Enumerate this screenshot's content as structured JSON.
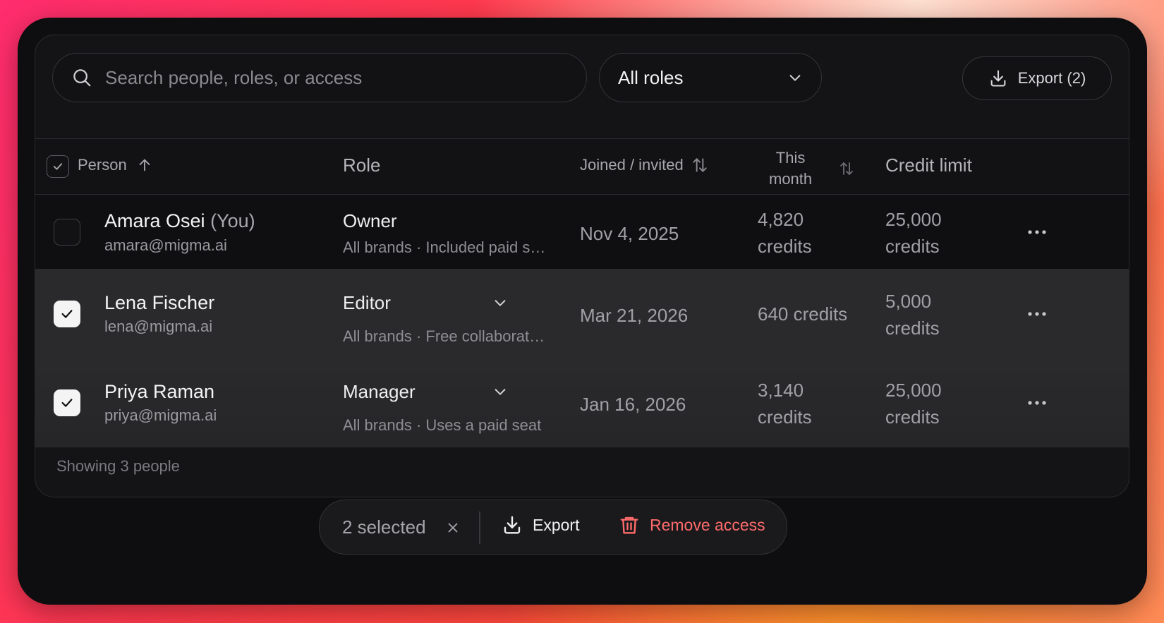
{
  "toolbar": {
    "search_placeholder": "Search people, roles, or access",
    "role_filter": "All roles",
    "export_label": "Export (2)"
  },
  "table": {
    "headers": {
      "person": "Person",
      "role": "Role",
      "joined": "Joined / invited",
      "month_line1": "This",
      "month_line2": "month",
      "limit": "Credit limit"
    },
    "rows": [
      {
        "name": "Amara Osei",
        "suffix": "(You)",
        "email": "amara@migma.ai",
        "role": "Owner",
        "role_sub": "All brands · Included paid s…",
        "joined": "Nov 4, 2025",
        "month_line1": "4,820",
        "month_line2": "credits",
        "limit_line1": "25,000",
        "limit_line2": "credits",
        "selected": false
      },
      {
        "name": "Lena Fischer",
        "email": "lena@migma.ai",
        "role": "Editor",
        "role_sub": "All brands · Free collaborat…",
        "joined": "Mar 21, 2026",
        "month_line1": "640 credits",
        "limit_line1": "5,000",
        "limit_line2": "credits",
        "selected": true
      },
      {
        "name": "Priya Raman",
        "email": "priya@migma.ai",
        "role": "Manager",
        "role_sub": "All brands · Uses a paid seat",
        "joined": "Jan 16, 2026",
        "month_line1": "3,140",
        "month_line2": "credits",
        "limit_line1": "25,000",
        "limit_line2": "credits",
        "selected": true
      }
    ],
    "footer": "Showing 3 people"
  },
  "actionbar": {
    "selected_label": "2 selected",
    "export_label": "Export",
    "remove_label": "Remove access"
  },
  "colors": {
    "accent_danger": "#ff6b6b",
    "panel_bg": "#141416"
  }
}
